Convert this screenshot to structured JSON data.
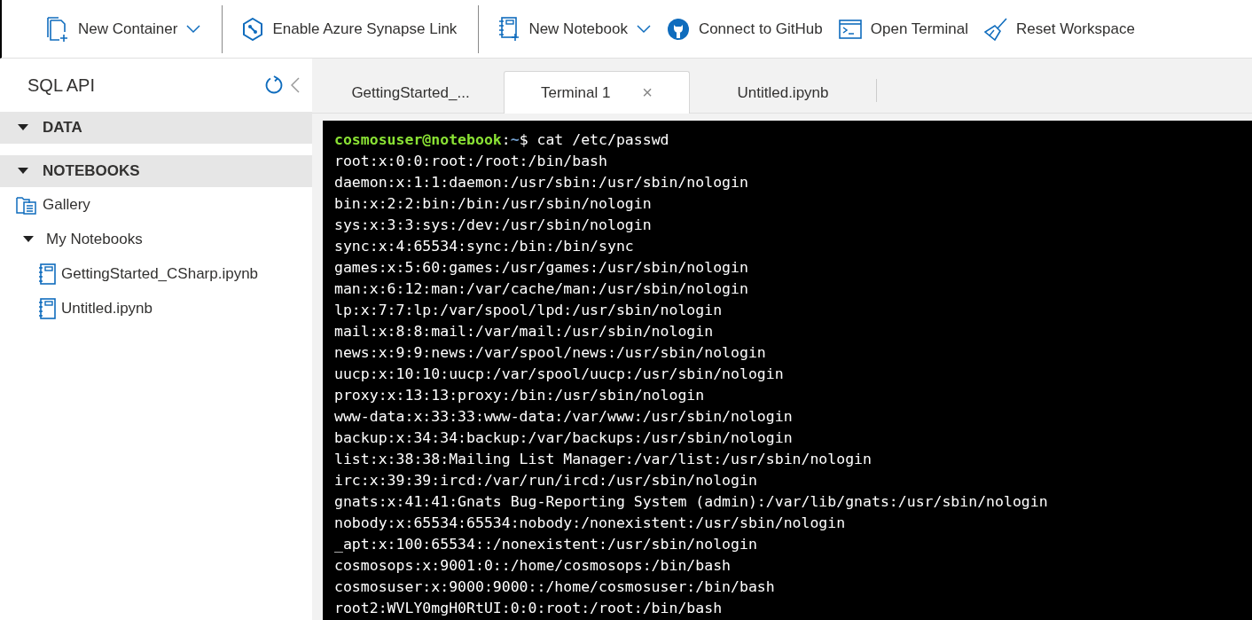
{
  "toolbar": {
    "items": [
      {
        "kind": "container",
        "label": "New Container",
        "dropdown": true
      },
      {
        "kind": "divider"
      },
      {
        "kind": "synapse",
        "label": "Enable Azure Synapse Link",
        "dropdown": false
      },
      {
        "kind": "divider"
      },
      {
        "kind": "notebook",
        "label": "New Notebook",
        "dropdown": true
      },
      {
        "kind": "github",
        "label": "Connect to GitHub",
        "dropdown": false
      },
      {
        "kind": "terminal",
        "label": "Open Terminal",
        "dropdown": false
      },
      {
        "kind": "broom",
        "label": "Reset Workspace",
        "dropdown": false
      }
    ]
  },
  "sidebar": {
    "title": "SQL API",
    "sections": [
      {
        "label": "DATA",
        "expanded": true
      },
      {
        "label": "NOTEBOOKS",
        "expanded": true,
        "items": [
          {
            "kind": "gallery",
            "label": "Gallery"
          },
          {
            "kind": "folder",
            "label": "My Notebooks",
            "expanded": true,
            "children": [
              {
                "kind": "notebook",
                "label": "GettingStarted_CSharp.ipynb"
              },
              {
                "kind": "notebook",
                "label": "Untitled.ipynb"
              }
            ]
          }
        ]
      }
    ]
  },
  "tabs": [
    {
      "label": "GettingStarted_...",
      "selected": false,
      "closable": false
    },
    {
      "label": "Terminal 1",
      "selected": true,
      "closable": true,
      "close": "×"
    },
    {
      "label": "Untitled.ipynb",
      "selected": false,
      "closable": false
    }
  ],
  "terminal": {
    "prompt": {
      "user_host": "cosmosuser@notebook",
      "separator": ":",
      "path": "~",
      "command": "$ cat /etc/passwd"
    },
    "lines": [
      "root:x:0:0:root:/root:/bin/bash",
      "daemon:x:1:1:daemon:/usr/sbin:/usr/sbin/nologin",
      "bin:x:2:2:bin:/bin:/usr/sbin/nologin",
      "sys:x:3:3:sys:/dev:/usr/sbin/nologin",
      "sync:x:4:65534:sync:/bin:/bin/sync",
      "games:x:5:60:games:/usr/games:/usr/sbin/nologin",
      "man:x:6:12:man:/var/cache/man:/usr/sbin/nologin",
      "lp:x:7:7:lp:/var/spool/lpd:/usr/sbin/nologin",
      "mail:x:8:8:mail:/var/mail:/usr/sbin/nologin",
      "news:x:9:9:news:/var/spool/news:/usr/sbin/nologin",
      "uucp:x:10:10:uucp:/var/spool/uucp:/usr/sbin/nologin",
      "proxy:x:13:13:proxy:/bin:/usr/sbin/nologin",
      "www-data:x:33:33:www-data:/var/www:/usr/sbin/nologin",
      "backup:x:34:34:backup:/var/backups:/usr/sbin/nologin",
      "list:x:38:38:Mailing List Manager:/var/list:/usr/sbin/nologin",
      "irc:x:39:39:ircd:/var/run/ircd:/usr/sbin/nologin",
      "gnats:x:41:41:Gnats Bug-Reporting System (admin):/var/lib/gnats:/usr/sbin/nologin",
      "nobody:x:65534:65534:nobody:/nonexistent:/usr/sbin/nologin",
      "_apt:x:100:65534::/nonexistent:/usr/sbin/nologin",
      "cosmosops:x:9001:0::/home/cosmosops:/bin/bash",
      "cosmosuser:x:9000:9000::/home/cosmosuser:/bin/bash",
      "root2:WVLY0mgH0RtUI:0:0:root:/root:/bin/bash"
    ]
  }
}
